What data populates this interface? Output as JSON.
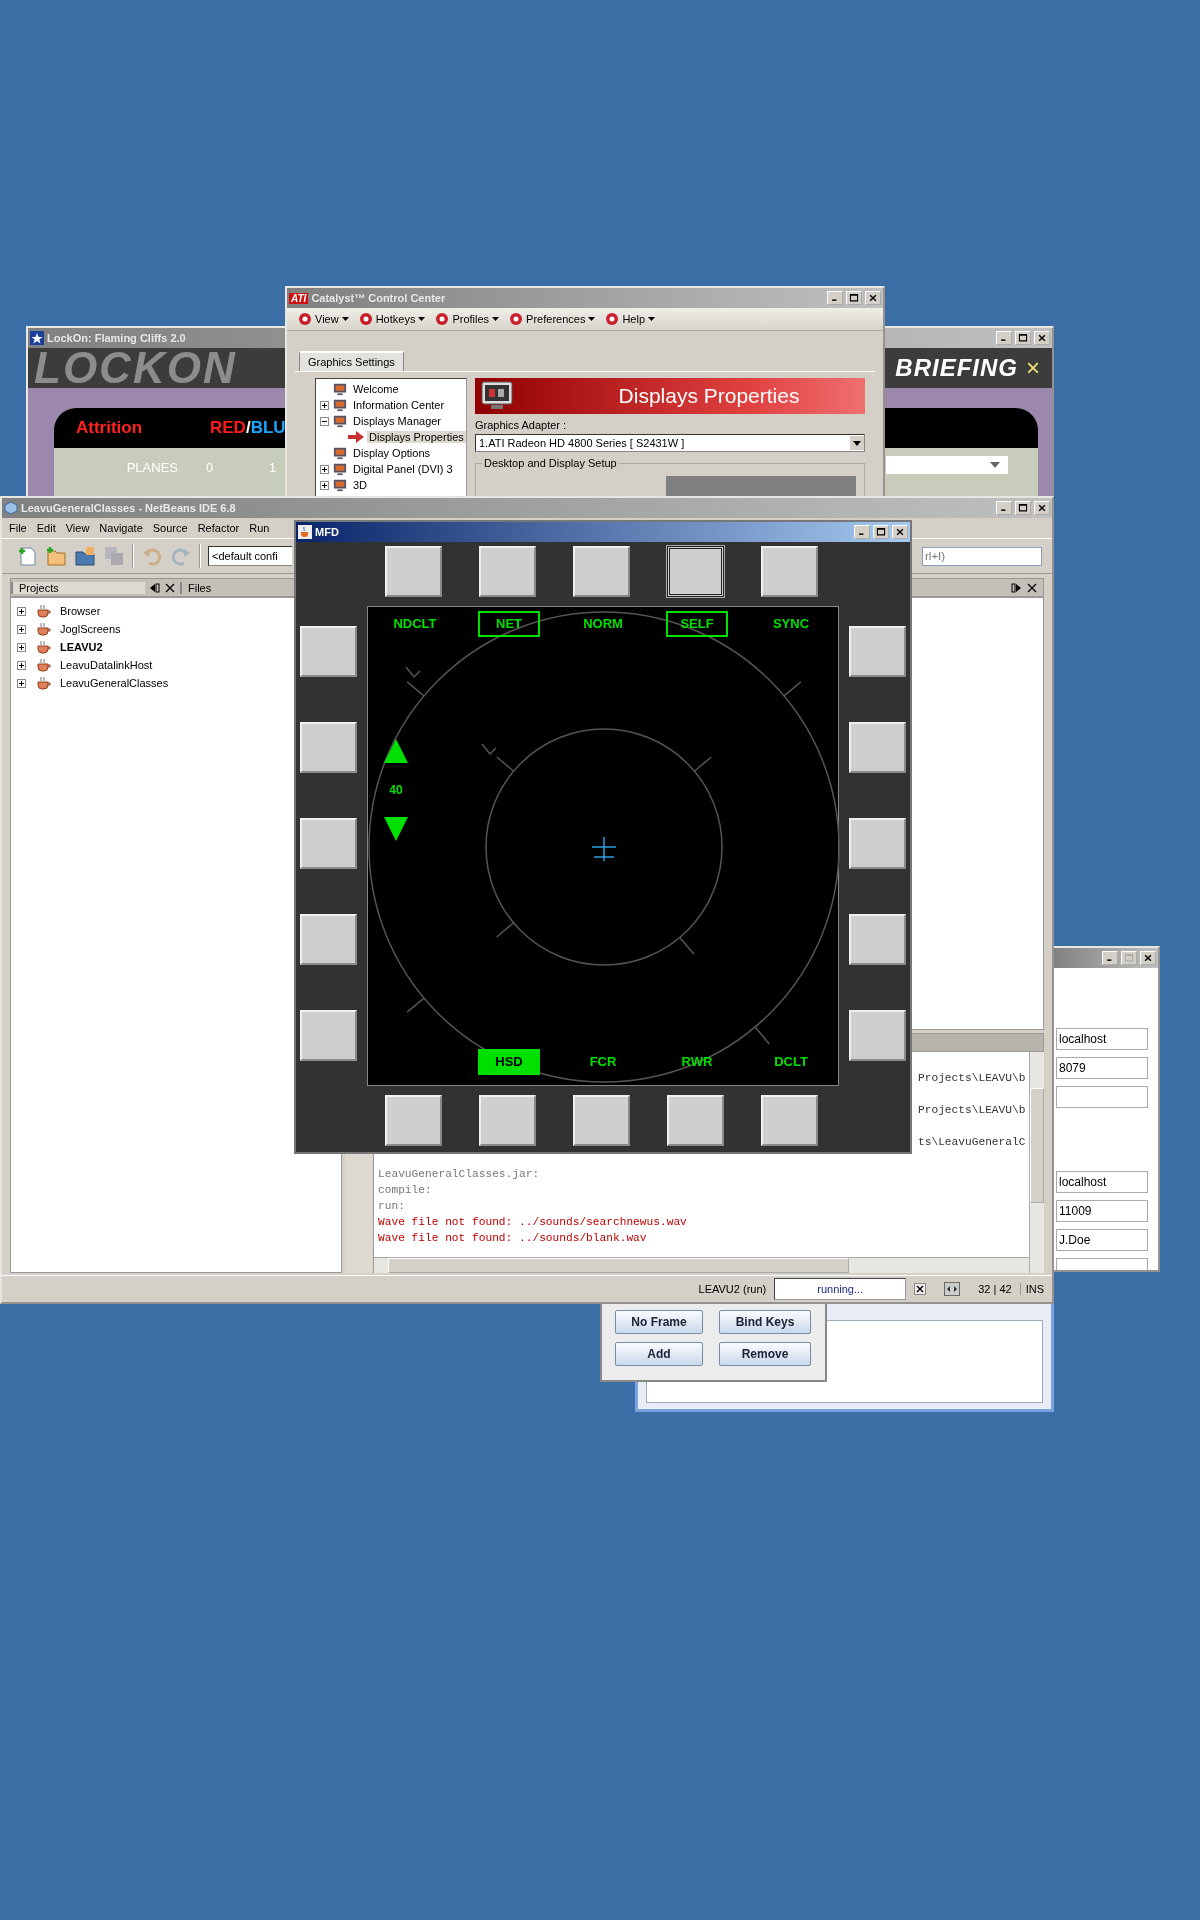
{
  "game_window": {
    "title": "LockOn: Flaming Cliffs 2.0",
    "logo": "LOCKON",
    "banner": "BRIEFING",
    "close_glyph": "×",
    "attrition": {
      "title": "Attrition",
      "separator": "/",
      "sides": [
        {
          "label": "RED",
          "color": "#ff1a1a"
        },
        {
          "label": "BLU",
          "color": "#19a7ff"
        }
      ],
      "rows": [
        {
          "label": "PLANES",
          "values": [
            "0",
            "1"
          ]
        }
      ]
    }
  },
  "catalyst_window": {
    "logo": "ATI",
    "title": "Catalyst™ Control Center",
    "menu": [
      {
        "label": "View"
      },
      {
        "label": "Hotkeys"
      },
      {
        "label": "Profiles"
      },
      {
        "label": "Preferences"
      },
      {
        "label": "Help"
      }
    ],
    "tabs": [
      {
        "label": "Graphics Settings",
        "selected": true
      }
    ],
    "tree": [
      {
        "label": "Welcome",
        "kind": "leaf",
        "selected": false
      },
      {
        "label": "Information Center",
        "kind": "group",
        "expanded": false,
        "selected": false
      },
      {
        "label": "Displays Manager",
        "kind": "group",
        "expanded": true,
        "selected": false,
        "children": [
          {
            "label": "Displays Properties",
            "kind": "page",
            "selected": true
          }
        ]
      },
      {
        "label": "Display Options",
        "kind": "leaf",
        "selected": false
      },
      {
        "label": "Digital Panel (DVI) 3",
        "kind": "group",
        "expanded": false,
        "selected": false
      },
      {
        "label": "3D",
        "kind": "group",
        "expanded": false,
        "selected": false
      }
    ],
    "banner": "Displays Properties",
    "adapter_label": "Graphics Adapter :",
    "adapter_value": "1.ATI Radeon HD 4800 Series [ S2431W ]",
    "setup_legend": "Desktop and Display Setup"
  },
  "ide_window": {
    "title": "LeavuGeneralClasses - NetBeans IDE 6.8",
    "menu": [
      "File",
      "Edit",
      "View",
      "Navigate",
      "Source",
      "Refactor",
      "Run"
    ],
    "config_combo": "<default confi",
    "search_field": "rl+I)",
    "panel_tabs": [
      {
        "label": "Projects",
        "selected": true
      },
      {
        "label": "Files",
        "selected": false
      }
    ],
    "projects": [
      {
        "label": "Browser",
        "main": false
      },
      {
        "label": "JoglScreens",
        "main": false
      },
      {
        "label": "LEAVU2",
        "main": true
      },
      {
        "label": "LeavuDatalinkHost",
        "main": false
      },
      {
        "label": "LeavuGeneralClasses",
        "main": false
      }
    ],
    "output_lines": [
      {
        "text": "Projects\\LEAVU\\b",
        "kind": "partial"
      },
      {
        "text": "Projects\\LEAVU\\b",
        "kind": "partial"
      },
      {
        "text": "ts\\LeavuGeneralC",
        "kind": "partial"
      },
      {
        "text": "LeavuGeneralClasses.jar:",
        "kind": "info"
      },
      {
        "text": "compile:",
        "kind": "info"
      },
      {
        "text": "run:",
        "kind": "info"
      },
      {
        "text": "Wave file not found: ../sounds/searchnewus.wav",
        "kind": "error"
      },
      {
        "text": "Wave file not found: ../sounds/blank.wav",
        "kind": "error"
      }
    ],
    "status": {
      "task": "LEAVU2 (run)",
      "progress": "running...",
      "position": "32 | 42",
      "mode": "INS"
    }
  },
  "mfd_window": {
    "title": "MFD",
    "top_buttons": [
      {
        "pressed": false
      },
      {
        "pressed": false
      },
      {
        "pressed": false
      },
      {
        "pressed": true
      },
      {
        "pressed": false
      }
    ],
    "top_labels": [
      {
        "label": "NDCLT",
        "boxed": false
      },
      {
        "label": "NET",
        "boxed": true
      },
      {
        "label": "NORM",
        "boxed": false
      },
      {
        "label": "SELF",
        "boxed": true
      },
      {
        "label": "SYNC",
        "boxed": false
      }
    ],
    "range": "40",
    "bottom_labels": [
      {
        "label": "HSD",
        "selected": true
      },
      {
        "label": "FCR",
        "selected": false
      },
      {
        "label": "RWR",
        "selected": false
      },
      {
        "label": "DCLT",
        "selected": false
      }
    ]
  },
  "connection_window": {
    "fields": [
      {
        "kind": "text",
        "value": "localhost"
      },
      {
        "kind": "text",
        "value": "8079"
      },
      {
        "kind": "blank"
      },
      {
        "kind": "text",
        "value": "localhost"
      },
      {
        "kind": "text",
        "value": "11009"
      },
      {
        "kind": "text",
        "value": "J.Doe"
      },
      {
        "kind": "blank"
      }
    ]
  },
  "button_dialog": {
    "buttons": [
      "No Frame",
      "Bind Keys",
      "Add",
      "Remove"
    ]
  }
}
